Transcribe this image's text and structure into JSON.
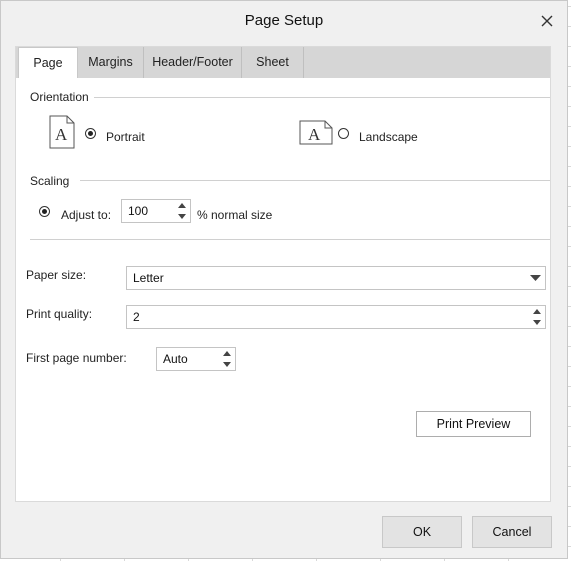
{
  "dialog": {
    "title": "Page Setup",
    "tabs": [
      {
        "label": "Page",
        "active": true
      },
      {
        "label": "Margins",
        "active": false
      },
      {
        "label": "Header/Footer",
        "active": false
      },
      {
        "label": "Sheet",
        "active": false
      }
    ],
    "orientation": {
      "label": "Orientation",
      "options": [
        {
          "label": "Portrait",
          "selected": true,
          "icon": "portrait-page-icon"
        },
        {
          "label": "Landscape",
          "selected": false,
          "icon": "landscape-page-icon"
        }
      ]
    },
    "scaling": {
      "label": "Scaling",
      "adjust_label": "Adjust to:",
      "adjust_value": "100",
      "adjust_suffix": "% normal size",
      "adjust_selected": true
    },
    "paper_size": {
      "label": "Paper size:",
      "value": "Letter"
    },
    "print_quality": {
      "label": "Print quality:",
      "value": "2"
    },
    "first_page_number": {
      "label": "First page number:",
      "value": "Auto"
    },
    "print_preview_label": "Print Preview",
    "ok_label": "OK",
    "cancel_label": "Cancel",
    "icon_color": "#555555"
  }
}
